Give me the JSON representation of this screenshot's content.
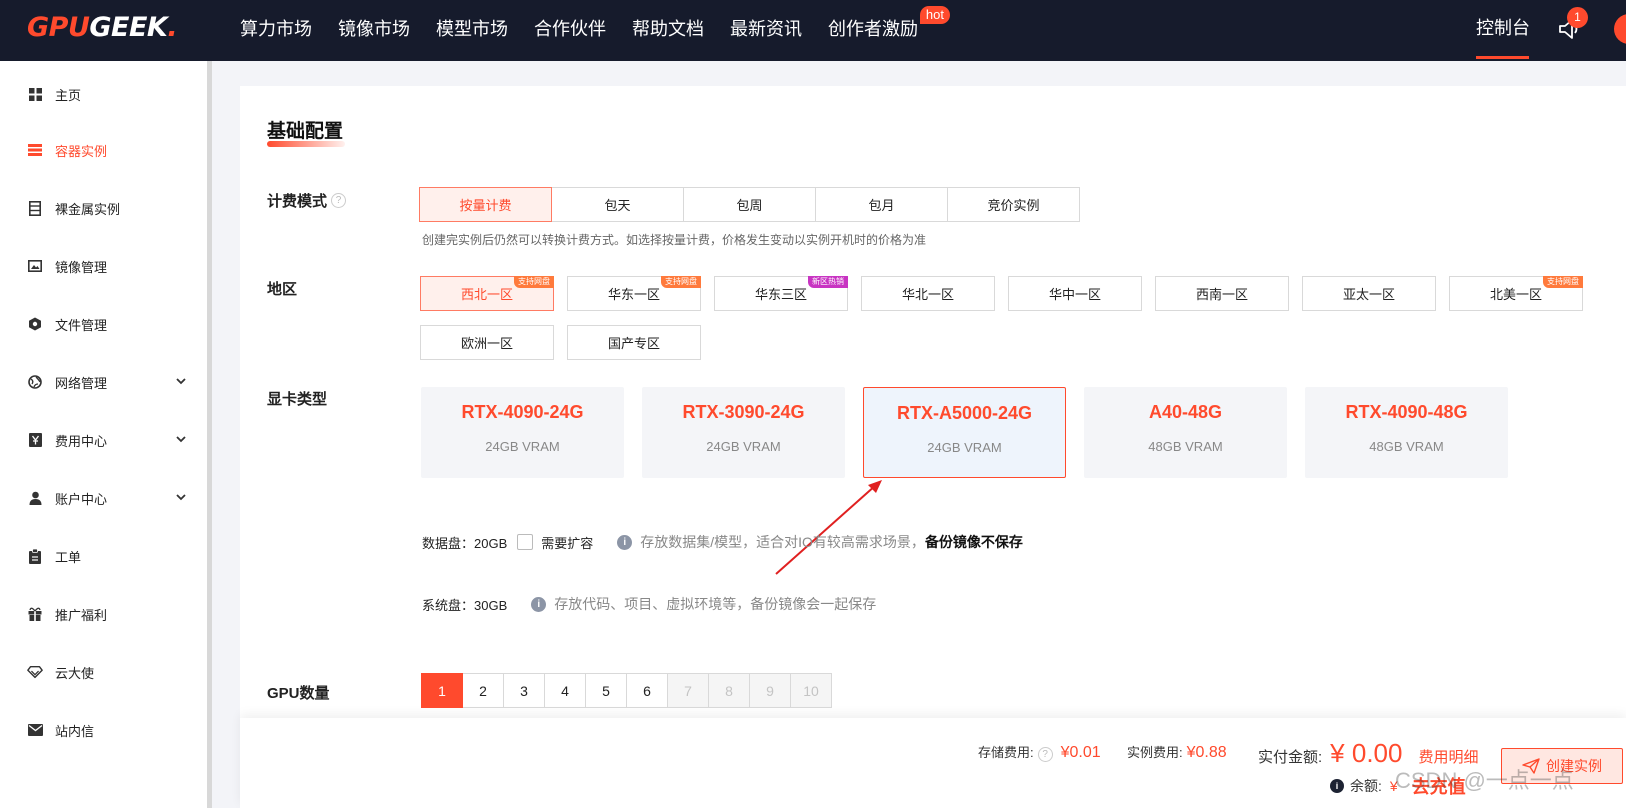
{
  "brand": {
    "logo_part1": "GPU",
    "logo_part2": "GEEK",
    "logo_dot": "."
  },
  "nav": {
    "items": [
      "算力市场",
      "镜像市场",
      "模型市场",
      "合作伙伴",
      "帮助文档",
      "最新资讯",
      "创作者激励"
    ],
    "hot_badge": "hot",
    "console": "控制台",
    "notification_count": "1"
  },
  "sidebar": {
    "items": [
      {
        "label": "主页",
        "icon": "grid-icon"
      },
      {
        "label": "容器实例",
        "icon": "list-icon",
        "active": true
      },
      {
        "label": "裸金属实例",
        "icon": "server-icon"
      },
      {
        "label": "镜像管理",
        "icon": "image-icon"
      },
      {
        "label": "文件管理",
        "icon": "hexagon-icon"
      },
      {
        "label": "网络管理",
        "icon": "globe-icon",
        "expandable": true
      },
      {
        "label": "费用中心",
        "icon": "yen-icon",
        "expandable": true
      },
      {
        "label": "账户中心",
        "icon": "user-icon",
        "expandable": true
      },
      {
        "label": "工单",
        "icon": "clipboard-icon"
      },
      {
        "label": "推广福利",
        "icon": "gift-icon"
      },
      {
        "label": "云大使",
        "icon": "diamond-icon"
      },
      {
        "label": "站内信",
        "icon": "mail-icon"
      }
    ]
  },
  "config": {
    "section_title": "基础配置",
    "billing_label": "计费模式",
    "billing_options": [
      "按量计费",
      "包天",
      "包周",
      "包月",
      "竞价实例"
    ],
    "billing_selected": 0,
    "billing_hint": "创建完实例后仍然可以转换计费方式。如选择按量计费，价格发生变动以实例开机时的价格为准",
    "region_label": "地区",
    "regions": [
      {
        "name": "西北一区",
        "tag": "支持网盘",
        "selected": true
      },
      {
        "name": "华东一区",
        "tag": "支持网盘"
      },
      {
        "name": "华东三区",
        "tag": "新区热销"
      },
      {
        "name": "华北一区"
      },
      {
        "name": "华中一区"
      },
      {
        "name": "西南一区"
      },
      {
        "name": "亚太一区"
      },
      {
        "name": "北美一区",
        "tag": "支持网盘"
      },
      {
        "name": "欧洲一区"
      },
      {
        "name": "国产专区"
      }
    ],
    "gpu_label": "显卡类型",
    "gpus": [
      {
        "name": "RTX-4090-24G",
        "vram": "24GB VRAM"
      },
      {
        "name": "RTX-3090-24G",
        "vram": "24GB VRAM"
      },
      {
        "name": "RTX-A5000-24G",
        "vram": "24GB VRAM",
        "selected": true
      },
      {
        "name": "A40-48G",
        "vram": "48GB VRAM"
      },
      {
        "name": "RTX-4090-48G",
        "vram": "48GB VRAM"
      }
    ],
    "data_disk": {
      "label": "数据盘：20GB",
      "expand_label": "需要扩容",
      "desc": "存放数据集/模型，适合对IO有较高需求场景，",
      "desc_bold": "备份镜像不保存"
    },
    "system_disk": {
      "label": "系统盘：30GB",
      "desc": "存放代码、项目、虚拟环境等，备份镜像会一起保存"
    },
    "gpu_count_label": "GPU数量",
    "gpu_counts": [
      "1",
      "2",
      "3",
      "4",
      "5",
      "6",
      "7",
      "8",
      "9",
      "10"
    ],
    "gpu_count_selected": 0,
    "gpu_count_max_enabled": 6
  },
  "footer": {
    "storage_fee_label": "存储费用:",
    "storage_fee": "¥0.01",
    "instance_fee_label": "实例费用:",
    "instance_fee": "¥0.88",
    "total_label": "实付金额:",
    "total": "¥ 0.00",
    "detail_link": "费用明细",
    "create_button": "创建实例",
    "balance_label": "余额:",
    "balance_value": "¥",
    "recharge": "去充值",
    "watermark": "CSDN @一点一点"
  },
  "colors": {
    "accent": "#ff4a2d",
    "topbar": "#161b2c"
  }
}
